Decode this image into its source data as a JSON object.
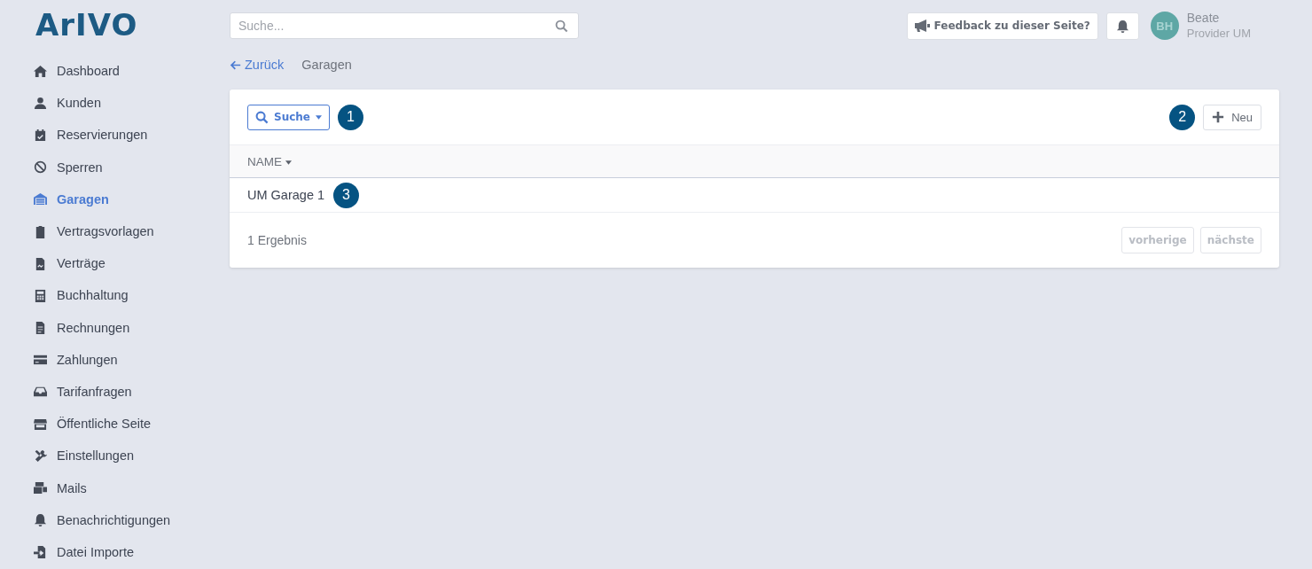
{
  "logo": "ArIVO",
  "sidebar": {
    "items": [
      {
        "label": "Dashboard",
        "selected": false
      },
      {
        "label": "Kunden",
        "selected": false
      },
      {
        "label": "Reservierungen",
        "selected": false
      },
      {
        "label": "Sperren",
        "selected": false
      },
      {
        "label": "Garagen",
        "selected": true
      },
      {
        "label": "Vertragsvorlagen",
        "selected": false
      },
      {
        "label": "Verträge",
        "selected": false
      },
      {
        "label": "Buchhaltung",
        "selected": false
      },
      {
        "label": "Rechnungen",
        "selected": false
      },
      {
        "label": "Zahlungen",
        "selected": false
      },
      {
        "label": "Tarifanfragen",
        "selected": false
      },
      {
        "label": "Öffentliche Seite",
        "selected": false
      },
      {
        "label": "Einstellungen",
        "selected": false
      },
      {
        "label": "Mails",
        "selected": false
      },
      {
        "label": "Benachrichtigungen",
        "selected": false
      },
      {
        "label": "Datei Importe",
        "selected": false
      }
    ]
  },
  "search": {
    "placeholder": "Suche..."
  },
  "header": {
    "feedback_button": "Feedback zu dieser Seite?",
    "user": {
      "initials": "BH",
      "name": "Beate",
      "role": "Provider UM"
    }
  },
  "breadcrumb": {
    "back": "Zurück",
    "current": "Garagen"
  },
  "card": {
    "search_button": {
      "label": "Suche",
      "annotation": "1"
    },
    "new_button": {
      "label": "Neu",
      "annotation": "2"
    },
    "table": {
      "columns": [
        {
          "label": "NAME",
          "sorted": true
        }
      ],
      "rows": [
        {
          "name": "UM Garage 1",
          "annotation": "3"
        }
      ]
    },
    "result_count": "1 Ergebnis",
    "pagination": [
      {
        "label": "vorherige",
        "disabled": true
      },
      {
        "label": "nächste",
        "disabled": true
      }
    ]
  }
}
